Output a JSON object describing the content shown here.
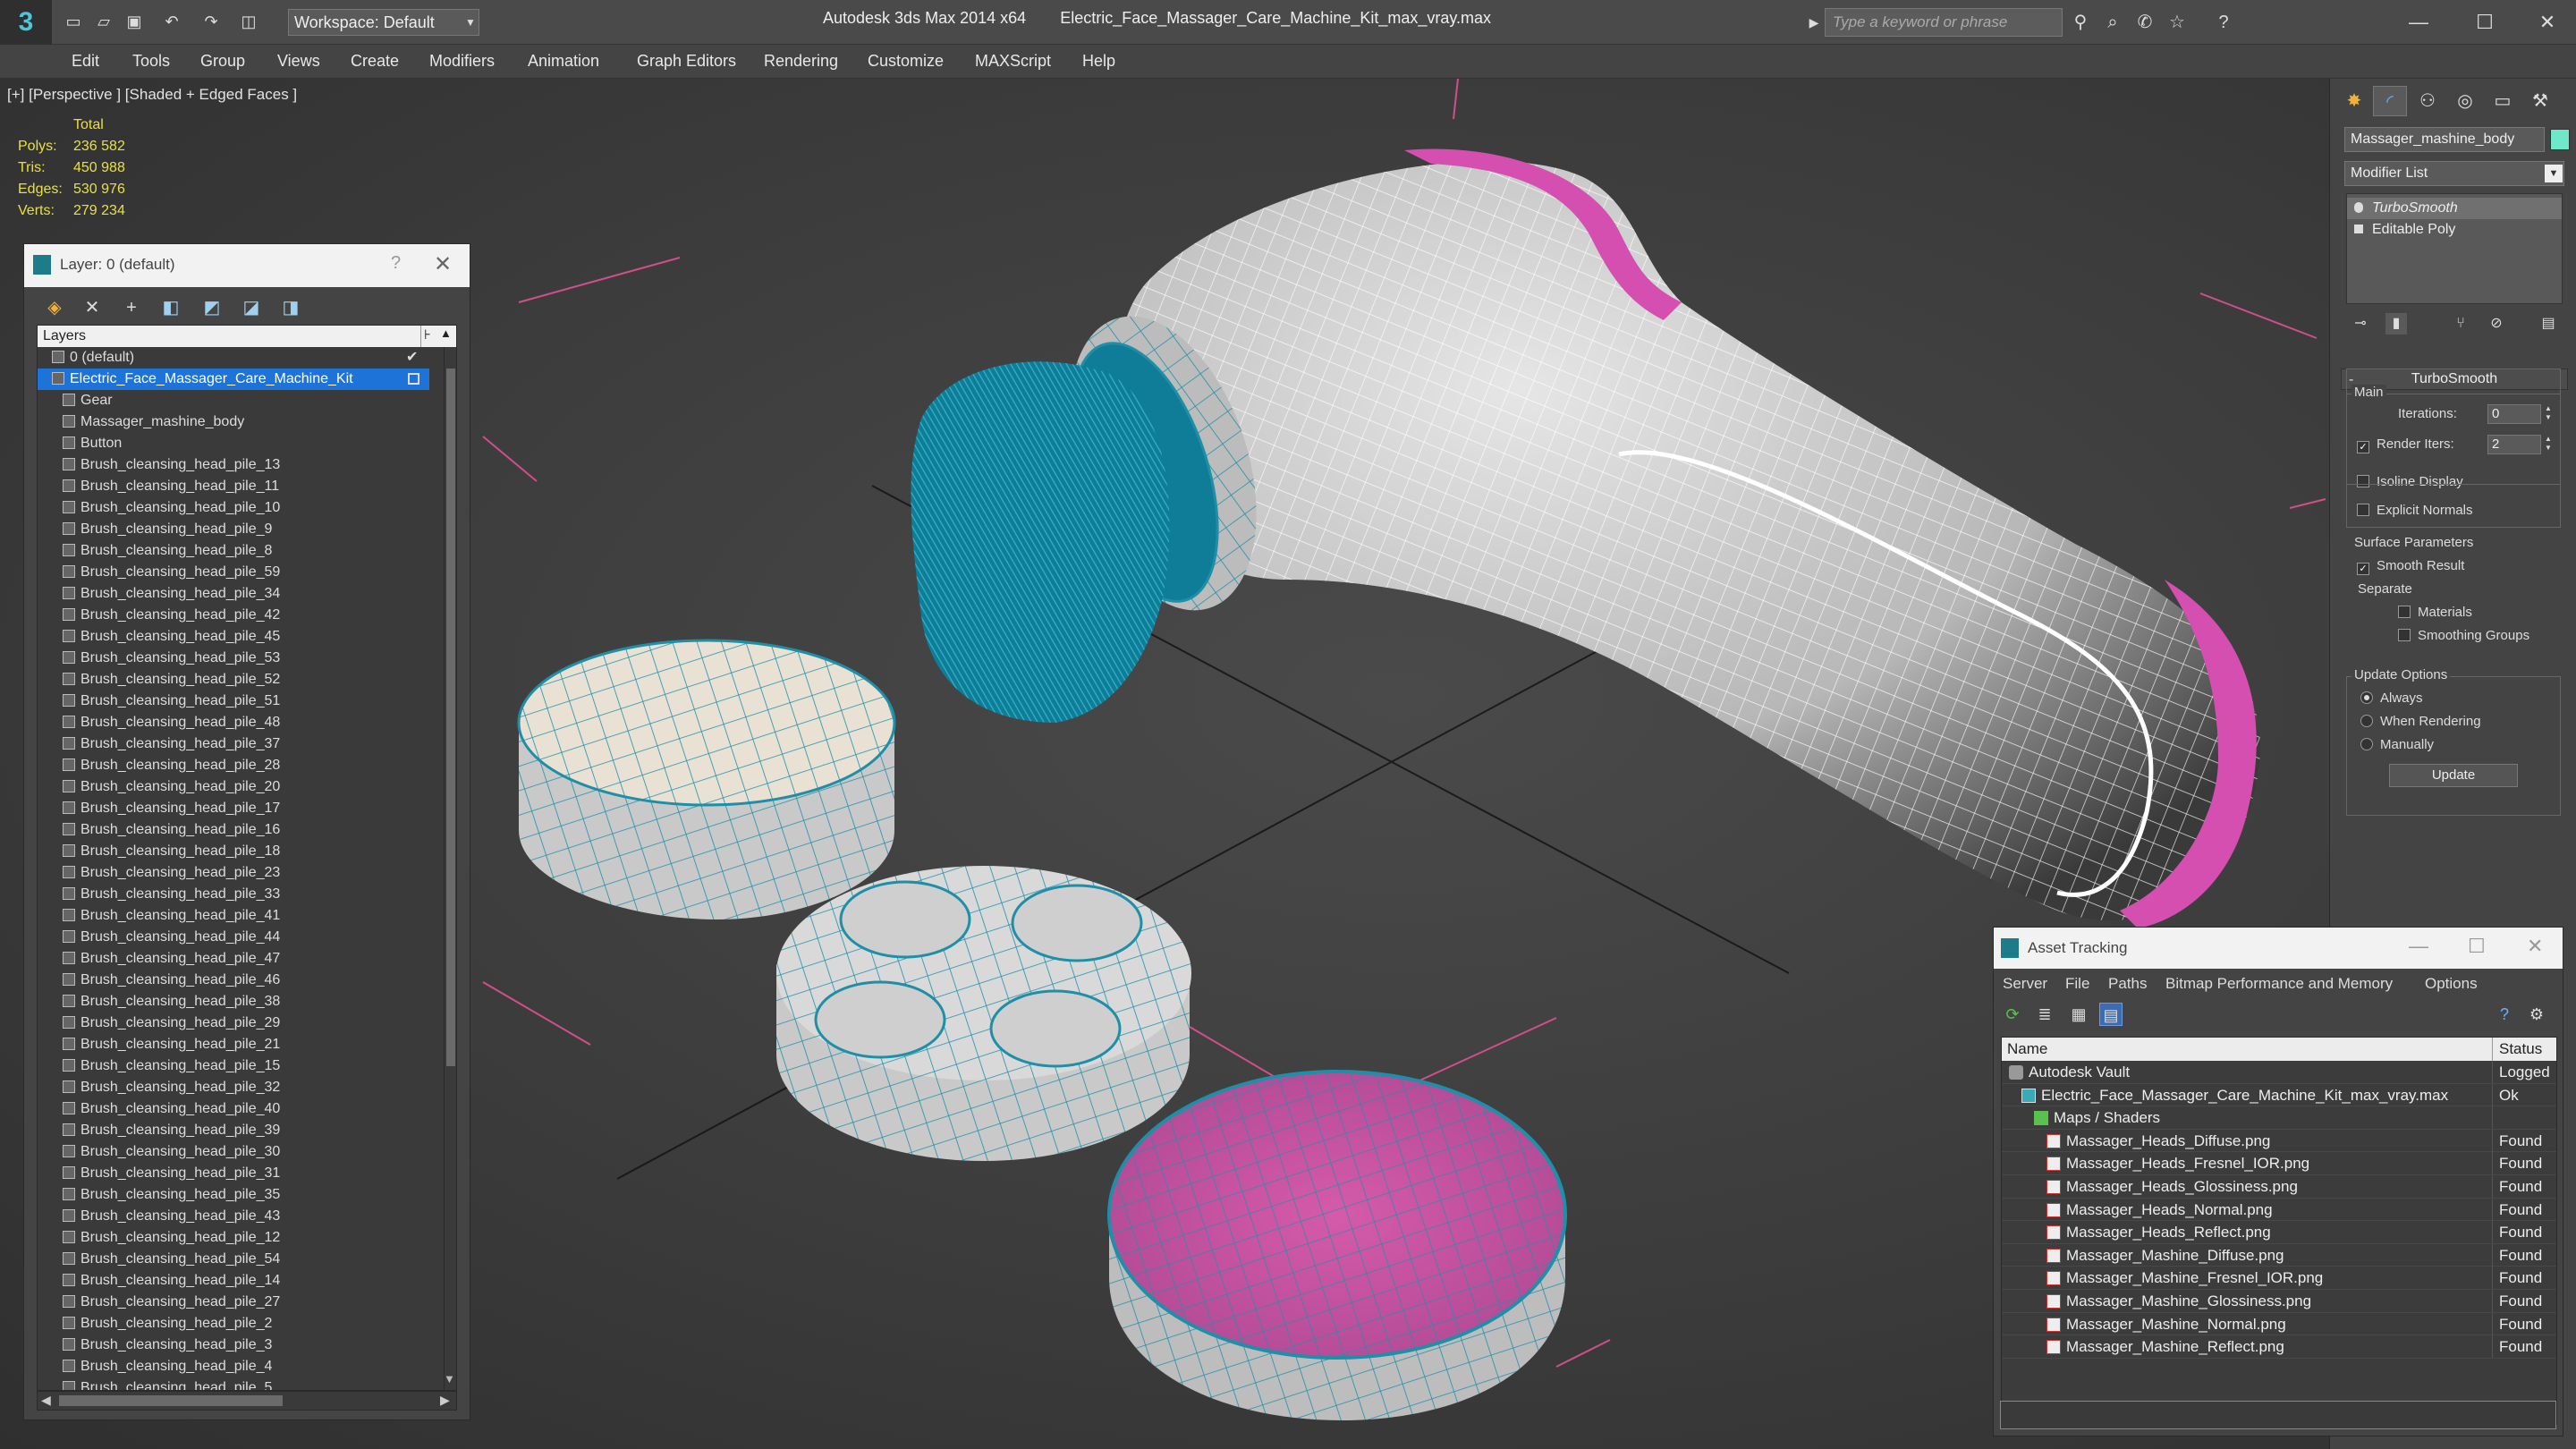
{
  "app": {
    "title": "Autodesk 3ds Max 2014 x64",
    "filename": "Electric_Face_Massager_Care_Machine_Kit_max_vray.max",
    "workspace": "Workspace: Default",
    "search_placeholder": "Type a keyword or phrase"
  },
  "menu": [
    "Edit",
    "Tools",
    "Group",
    "Views",
    "Create",
    "Modifiers",
    "Animation",
    "Graph Editors",
    "Rendering",
    "Customize",
    "MAXScript",
    "Help"
  ],
  "viewport": {
    "label": "[+] [Perspective ] [Shaded + Edged Faces ]",
    "stats_header": "Total",
    "stats": [
      {
        "label": "Polys:",
        "value": "236 582"
      },
      {
        "label": "Tris:",
        "value": "450 988"
      },
      {
        "label": "Edges:",
        "value": "530 976"
      },
      {
        "label": "Verts:",
        "value": "279 234"
      }
    ]
  },
  "layer_panel": {
    "title": "Layer: 0 (default)",
    "help": "?",
    "column": "Layers",
    "rows": [
      {
        "name": "0 (default)",
        "level": 1,
        "kind": "layer",
        "checked": true
      },
      {
        "name": "Electric_Face_Massager_Care_Machine_Kit",
        "level": 1,
        "kind": "layer",
        "selected": true
      },
      {
        "name": "Gear",
        "level": 2,
        "kind": "object"
      },
      {
        "name": "Massager_mashine_body",
        "level": 2,
        "kind": "object"
      },
      {
        "name": "Button",
        "level": 2,
        "kind": "object"
      },
      {
        "name": "Brush_cleansing_head_pile_13",
        "level": 2,
        "kind": "object"
      },
      {
        "name": "Brush_cleansing_head_pile_11",
        "level": 2,
        "kind": "object"
      },
      {
        "name": "Brush_cleansing_head_pile_10",
        "level": 2,
        "kind": "object"
      },
      {
        "name": "Brush_cleansing_head_pile_9",
        "level": 2,
        "kind": "object"
      },
      {
        "name": "Brush_cleansing_head_pile_8",
        "level": 2,
        "kind": "object"
      },
      {
        "name": "Brush_cleansing_head_pile_59",
        "level": 2,
        "kind": "object"
      },
      {
        "name": "Brush_cleansing_head_pile_34",
        "level": 2,
        "kind": "object"
      },
      {
        "name": "Brush_cleansing_head_pile_42",
        "level": 2,
        "kind": "object"
      },
      {
        "name": "Brush_cleansing_head_pile_45",
        "level": 2,
        "kind": "object"
      },
      {
        "name": "Brush_cleansing_head_pile_53",
        "level": 2,
        "kind": "object"
      },
      {
        "name": "Brush_cleansing_head_pile_52",
        "level": 2,
        "kind": "object"
      },
      {
        "name": "Brush_cleansing_head_pile_51",
        "level": 2,
        "kind": "object"
      },
      {
        "name": "Brush_cleansing_head_pile_48",
        "level": 2,
        "kind": "object"
      },
      {
        "name": "Brush_cleansing_head_pile_37",
        "level": 2,
        "kind": "object"
      },
      {
        "name": "Brush_cleansing_head_pile_28",
        "level": 2,
        "kind": "object"
      },
      {
        "name": "Brush_cleansing_head_pile_20",
        "level": 2,
        "kind": "object"
      },
      {
        "name": "Brush_cleansing_head_pile_17",
        "level": 2,
        "kind": "object"
      },
      {
        "name": "Brush_cleansing_head_pile_16",
        "level": 2,
        "kind": "object"
      },
      {
        "name": "Brush_cleansing_head_pile_18",
        "level": 2,
        "kind": "object"
      },
      {
        "name": "Brush_cleansing_head_pile_23",
        "level": 2,
        "kind": "object"
      },
      {
        "name": "Brush_cleansing_head_pile_33",
        "level": 2,
        "kind": "object"
      },
      {
        "name": "Brush_cleansing_head_pile_41",
        "level": 2,
        "kind": "object"
      },
      {
        "name": "Brush_cleansing_head_pile_44",
        "level": 2,
        "kind": "object"
      },
      {
        "name": "Brush_cleansing_head_pile_47",
        "level": 2,
        "kind": "object"
      },
      {
        "name": "Brush_cleansing_head_pile_46",
        "level": 2,
        "kind": "object"
      },
      {
        "name": "Brush_cleansing_head_pile_38",
        "level": 2,
        "kind": "object"
      },
      {
        "name": "Brush_cleansing_head_pile_29",
        "level": 2,
        "kind": "object"
      },
      {
        "name": "Brush_cleansing_head_pile_21",
        "level": 2,
        "kind": "object"
      },
      {
        "name": "Brush_cleansing_head_pile_15",
        "level": 2,
        "kind": "object"
      },
      {
        "name": "Brush_cleansing_head_pile_32",
        "level": 2,
        "kind": "object"
      },
      {
        "name": "Brush_cleansing_head_pile_40",
        "level": 2,
        "kind": "object"
      },
      {
        "name": "Brush_cleansing_head_pile_39",
        "level": 2,
        "kind": "object"
      },
      {
        "name": "Brush_cleansing_head_pile_30",
        "level": 2,
        "kind": "object"
      },
      {
        "name": "Brush_cleansing_head_pile_31",
        "level": 2,
        "kind": "object"
      },
      {
        "name": "Brush_cleansing_head_pile_35",
        "level": 2,
        "kind": "object"
      },
      {
        "name": "Brush_cleansing_head_pile_43",
        "level": 2,
        "kind": "object"
      },
      {
        "name": "Brush_cleansing_head_pile_12",
        "level": 2,
        "kind": "object"
      },
      {
        "name": "Brush_cleansing_head_pile_54",
        "level": 2,
        "kind": "object"
      },
      {
        "name": "Brush_cleansing_head_pile_14",
        "level": 2,
        "kind": "object"
      },
      {
        "name": "Brush_cleansing_head_pile_27",
        "level": 2,
        "kind": "object"
      },
      {
        "name": "Brush_cleansing_head_pile_2",
        "level": 2,
        "kind": "object"
      },
      {
        "name": "Brush_cleansing_head_pile_3",
        "level": 2,
        "kind": "object"
      },
      {
        "name": "Brush_cleansing_head_pile_4",
        "level": 2,
        "kind": "object"
      },
      {
        "name": "Brush_cleansing_head_pile_5",
        "level": 2,
        "kind": "object"
      }
    ]
  },
  "command_panel": {
    "object_name": "Massager_mashine_body",
    "object_color": "#6ee8c8",
    "modifier_list": "Modifier List",
    "stack": [
      "TurboSmooth",
      "Editable Poly"
    ],
    "turbosmooth": {
      "title": "TurboSmooth",
      "main_label": "Main",
      "iterations_label": "Iterations:",
      "iterations_value": "0",
      "render_iters_label": "Render Iters:",
      "render_iters_value": "2",
      "render_iters_checked": true,
      "isoline_display": "Isoline Display",
      "explicit_normals": "Explicit Normals",
      "surface_params_label": "Surface Parameters",
      "smooth_result": "Smooth Result",
      "separate_label": "Separate",
      "materials": "Materials",
      "smoothing_groups": "Smoothing Groups",
      "update_options_label": "Update Options",
      "always": "Always",
      "when_rendering": "When Rendering",
      "manually": "Manually",
      "update_button": "Update"
    }
  },
  "asset_tracking": {
    "title": "Asset Tracking",
    "menu": [
      "Server",
      "File",
      "Paths",
      "Bitmap Performance and Memory",
      "Options"
    ],
    "col_name": "Name",
    "col_status": "Status",
    "rows": [
      {
        "name": "Autodesk Vault",
        "status": "Logged",
        "indent": 1,
        "icon": "vault"
      },
      {
        "name": "Electric_Face_Massager_Care_Machine_Kit_max_vray.max",
        "status": "Ok",
        "indent": 2,
        "icon": "file"
      },
      {
        "name": "Maps / Shaders",
        "status": "",
        "indent": 3,
        "icon": "maps"
      },
      {
        "name": "Massager_Heads_Diffuse.png",
        "status": "Found",
        "indent": 4,
        "icon": "png"
      },
      {
        "name": "Massager_Heads_Fresnel_IOR.png",
        "status": "Found",
        "indent": 4,
        "icon": "png"
      },
      {
        "name": "Massager_Heads_Glossiness.png",
        "status": "Found",
        "indent": 4,
        "icon": "png"
      },
      {
        "name": "Massager_Heads_Normal.png",
        "status": "Found",
        "indent": 4,
        "icon": "png"
      },
      {
        "name": "Massager_Heads_Reflect.png",
        "status": "Found",
        "indent": 4,
        "icon": "png"
      },
      {
        "name": "Massager_Mashine_Diffuse.png",
        "status": "Found",
        "indent": 4,
        "icon": "png"
      },
      {
        "name": "Massager_Mashine_Fresnel_IOR.png",
        "status": "Found",
        "indent": 4,
        "icon": "png"
      },
      {
        "name": "Massager_Mashine_Glossiness.png",
        "status": "Found",
        "indent": 4,
        "icon": "png"
      },
      {
        "name": "Massager_Mashine_Normal.png",
        "status": "Found",
        "indent": 4,
        "icon": "png"
      },
      {
        "name": "Massager_Mashine_Reflect.png",
        "status": "Found",
        "indent": 4,
        "icon": "png"
      }
    ]
  },
  "colors": {
    "selection": "#1e73d8",
    "stats_text": "#e8e040",
    "wire": "#1f8fa8",
    "brush_bristles": "#0f7d98",
    "pink_accent": "#d44fb0"
  }
}
